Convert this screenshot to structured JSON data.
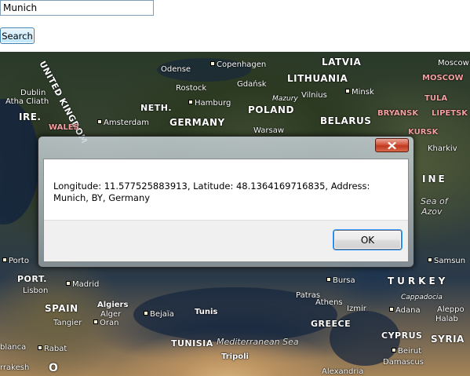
{
  "search": {
    "value": "Munich",
    "button_label": "Search"
  },
  "map": {
    "countries": [
      "LATVIA",
      "LITHUANIA",
      "POLAND",
      "GERMANY",
      "NETH.",
      "BELARUS",
      "IRE.",
      "PORT.",
      "SPAIN",
      "TUNISIA",
      "GREECE",
      "TURKEY",
      "CYPRUS",
      "SYRIA",
      "UNITED KINGDOM"
    ],
    "regions": [
      "MOSCOW",
      "TULA",
      "BRYANSK",
      "LIPETSK",
      "KURSK",
      "WALES"
    ],
    "cities": [
      "Odense",
      "Copenhagen",
      "Rostock",
      "Gdańsk",
      "Hamburg",
      "Amsterdam",
      "Warsaw",
      "Vilnius",
      "Minsk",
      "Mazury",
      "Dublin",
      "Atha Cliath",
      "Moscow",
      "Kharkiv",
      "Porto",
      "Lisbon",
      "Madrid",
      "Algiers",
      "Alger",
      "Oran",
      "Bejaïa",
      "Tunis",
      "Tangier",
      "Rabat",
      "rrakesh",
      "Bursa",
      "Patras",
      "Athens",
      "Izmir",
      "Adana",
      "Aleppo",
      "Halab",
      "Beirut",
      "Damascus",
      "Tripoli",
      "Alexandria",
      "Samsun",
      "Cappadocia",
      "Azov",
      "blanca"
    ],
    "water": [
      "Mediterranean Sea",
      "Sea of"
    ],
    "fragments": [
      "INE",
      "O"
    ]
  },
  "dialog": {
    "message": "Longitude: 11.577525883913, Latitude: 48.1364169716835, Address: Munich, BY, Germany",
    "ok_label": "OK",
    "close_icon": "close-icon"
  }
}
